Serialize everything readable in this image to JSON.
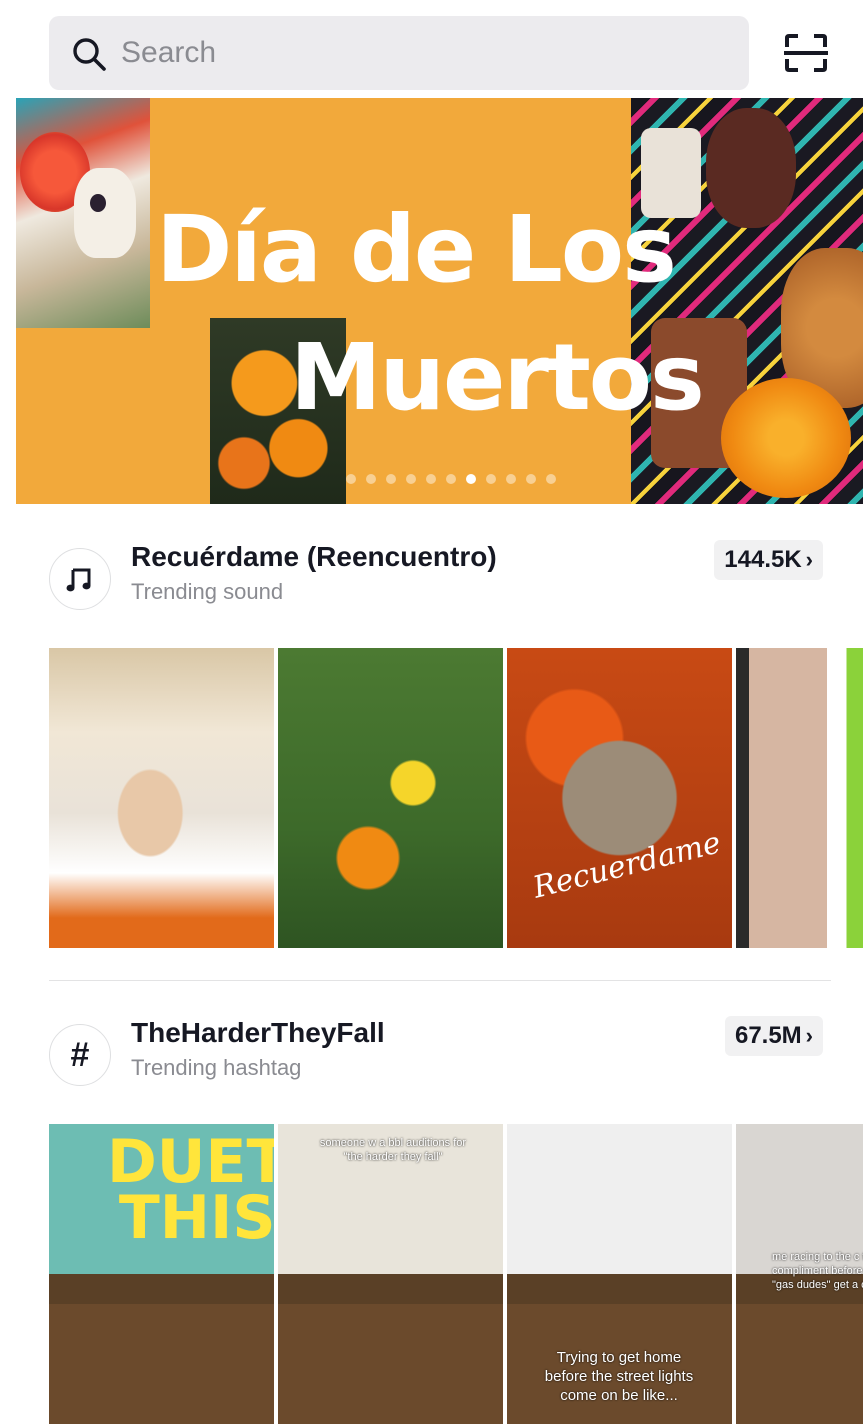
{
  "search": {
    "placeholder": "Search"
  },
  "banner": {
    "title_line1": "Día de Los",
    "title_line2": "Muertos",
    "dots_total": 11,
    "dots_active_index": 6
  },
  "sections": [
    {
      "icon": "music-note-icon",
      "title": "Recuérdame (Reencuentro)",
      "subtitle": "Trending sound",
      "count": "144.5K",
      "thumbnails": [
        {
          "caption": ""
        },
        {
          "caption": ""
        },
        {
          "caption": "Recuerdame"
        },
        {
          "caption": ""
        }
      ]
    },
    {
      "icon": "hashtag-icon",
      "icon_glyph": "#",
      "title": "TheHarderTheyFall",
      "subtitle": "Trending hashtag",
      "count": "67.5M",
      "thumbnails": [
        {
          "caption": "DUET\nTHIS"
        },
        {
          "caption": "someone w a bbl auditions for \"the harder they fall\""
        },
        {
          "caption": "Trying to get home before the street lights come on be like..."
        },
        {
          "caption": "me racing to the c to compliment before the \"gas dudes\" get a c"
        }
      ]
    }
  ],
  "colors": {
    "banner_bg": "#f2a93b",
    "text": "#161823",
    "muted": "#8a8b91"
  }
}
